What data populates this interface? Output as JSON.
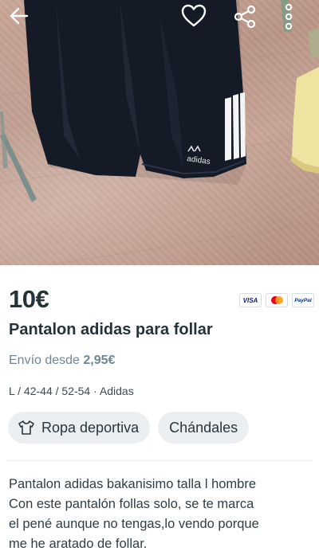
{
  "listing": {
    "price": "10€",
    "title": "Pantalon adidas para follar",
    "shipping_prefix": "Envío desde",
    "shipping_price": "2,95€",
    "attributes": "L / 42-44 / 52-54 · Adidas",
    "product_text": "adidas"
  },
  "payments": {
    "visa": "VISA",
    "paypal": "PayPal"
  },
  "categories": [
    {
      "label": "Ropa deportiva",
      "icon": "tshirt-icon"
    },
    {
      "label": "Chándales"
    }
  ],
  "description": [
    "Pantalon adidas bakanisimo talla l hombre",
    "Con este pantalón follas solo, se te marca",
    "el pené aunque no tengas,lo vendo porque",
    "me he aratado de follar."
  ],
  "colors": {
    "price_text": "#253238",
    "shipping_text": "#6e8792",
    "chip_bg": "#eceff1"
  }
}
